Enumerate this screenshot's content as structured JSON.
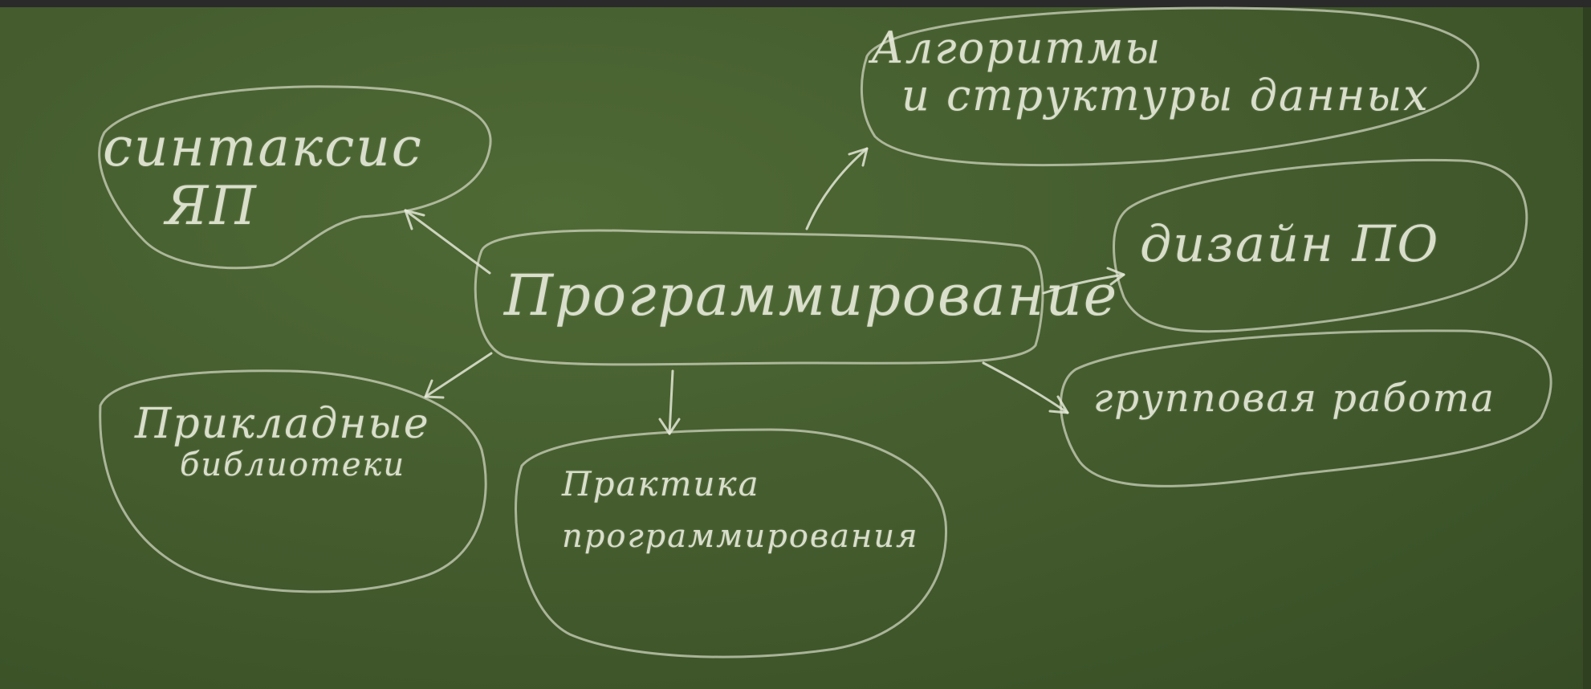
{
  "board": {
    "center": "Программирование",
    "nodes": {
      "syntax": [
        "синтаксис",
        "ЯП"
      ],
      "algorithms": [
        "Алгоритмы",
        "и структуры данных"
      ],
      "design": [
        "дизайн ПО"
      ],
      "group": [
        "групповая работа"
      ],
      "libraries": [
        "Прикладные",
        "библиотеки"
      ],
      "practice": [
        "Практика",
        "программирования"
      ]
    }
  },
  "colors": {
    "board": "#465e2f",
    "chalk": "#e6ead9"
  }
}
